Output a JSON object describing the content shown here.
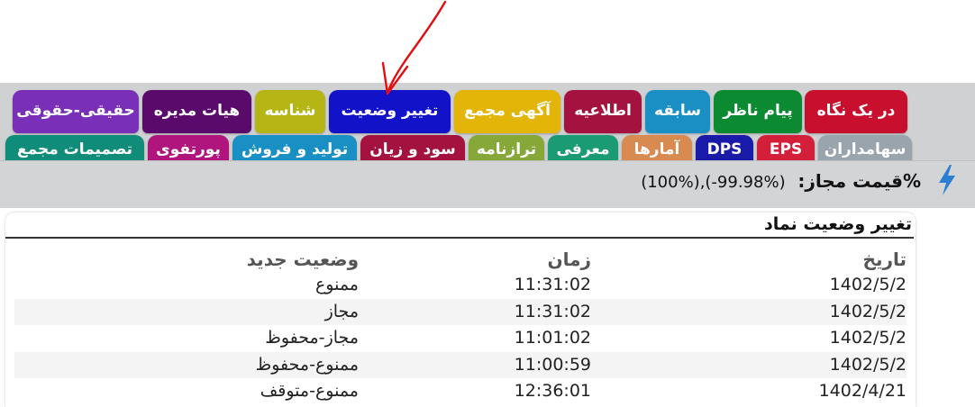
{
  "tabs_row1": [
    {
      "label": "در یک نگاه",
      "color": "#c8102e"
    },
    {
      "label": "پیام ناظر",
      "color": "#0b8a32"
    },
    {
      "label": "سابقه",
      "color": "#1a8fc4"
    },
    {
      "label": "اطلاعیه",
      "color": "#a4123f"
    },
    {
      "label": "آگهی مجمع",
      "color": "#e3b509"
    },
    {
      "label": "تغییر وضعیت",
      "color": "#1212c8"
    },
    {
      "label": "شناسه",
      "color": "#b5b515"
    },
    {
      "label": "هیات مدیره",
      "color": "#5a0a6b"
    },
    {
      "label": "حقیقی-حقوقی",
      "color": "#7a2fb8"
    }
  ],
  "tabs_row2": [
    {
      "label": "سهامداران",
      "color": "#9aa4ad"
    },
    {
      "label": "EPS",
      "color": "#d41f3a"
    },
    {
      "label": "DPS",
      "color": "#1a1aa8"
    },
    {
      "label": "آمارها",
      "color": "#d98a50"
    },
    {
      "label": "معرفی",
      "color": "#1a9b73"
    },
    {
      "label": "ترازنامه",
      "color": "#86a838"
    },
    {
      "label": "سود و زیان",
      "color": "#a4123f"
    },
    {
      "label": "تولید و فروش",
      "color": "#1a8fc4"
    },
    {
      "label": "پورتفوی",
      "color": "#b0157e"
    },
    {
      "label": "تصمیمات مجمع",
      "color": "#0f8c7a"
    }
  ],
  "price": {
    "label": "%قیمت مجاز:",
    "values": "(100%),(-99.98%)"
  },
  "panel": {
    "title": "تغییر وضعیت نماد",
    "headers": {
      "date": "تاریخ",
      "time": "زمان",
      "status": "وضعیت جدید"
    },
    "rows": [
      {
        "date": "1402/5/2",
        "time": "11:31:02",
        "status": "ممنوع"
      },
      {
        "date": "1402/5/2",
        "time": "11:31:02",
        "status": "مجاز"
      },
      {
        "date": "1402/5/2",
        "time": "11:01:02",
        "status": "مجاز-محفوظ"
      },
      {
        "date": "1402/5/2",
        "time": "11:00:59",
        "status": "ممنوع-محفوظ"
      },
      {
        "date": "1402/4/21",
        "time": "12:36:01",
        "status": "ممنوع-متوقف"
      }
    ]
  },
  "icons": {
    "bolt": "lightning-bolt-icon",
    "bolt_color": "#2a7fd4",
    "annotation_color": "#e01010"
  }
}
